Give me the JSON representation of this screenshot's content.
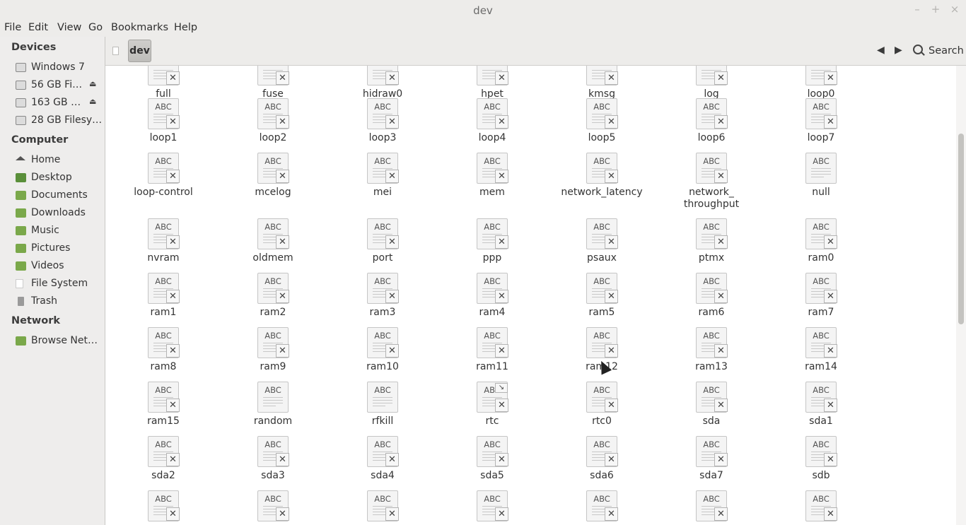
{
  "window": {
    "title": "dev",
    "minimize": "–",
    "maximize": "+",
    "close": "×"
  },
  "menu": [
    "File",
    "Edit",
    "View",
    "Go",
    "Bookmarks",
    "Help"
  ],
  "sidebar": {
    "devices_header": "Devices",
    "devices": [
      {
        "label": "Windows 7",
        "eject": false
      },
      {
        "label": "56 GB Fi…",
        "eject": true
      },
      {
        "label": "163 GB …",
        "eject": true
      },
      {
        "label": "28 GB Filesy…",
        "eject": false
      }
    ],
    "computer_header": "Computer",
    "computer": [
      {
        "label": "Home",
        "icon": "home-icon"
      },
      {
        "label": "Desktop",
        "icon": "desktop-folder-icon"
      },
      {
        "label": "Documents",
        "icon": "documents-folder-icon"
      },
      {
        "label": "Downloads",
        "icon": "downloads-folder-icon"
      },
      {
        "label": "Music",
        "icon": "music-folder-icon"
      },
      {
        "label": "Pictures",
        "icon": "pictures-folder-icon"
      },
      {
        "label": "Videos",
        "icon": "videos-folder-icon"
      },
      {
        "label": "File System",
        "icon": "file-system-icon"
      },
      {
        "label": "Trash",
        "icon": "trash-icon"
      }
    ],
    "network_header": "Network",
    "network": [
      {
        "label": "Browse Net…",
        "icon": "network-icon"
      }
    ],
    "eject_symbol": "⏏"
  },
  "toolbar": {
    "crumb": "dev",
    "back": "◀",
    "forward": "▶",
    "search_label": "Search"
  },
  "files": {
    "icon_text": "ABC",
    "x_symbol": "✕",
    "link_symbol": "↘",
    "rows": [
      [
        "full",
        "fuse",
        "hidraw0",
        "hpet",
        "kmsg",
        "log",
        "loop0"
      ],
      [
        "loop1",
        "loop2",
        "loop3",
        "loop4",
        "loop5",
        "loop6",
        "loop7"
      ],
      [
        "loop-control",
        "mcelog",
        "mei",
        "mem",
        "network_latency",
        "network_\nthroughput",
        "null"
      ],
      [
        "nvram",
        "oldmem",
        "port",
        "ppp",
        "psaux",
        "ptmx",
        "ram0"
      ],
      [
        "ram1",
        "ram2",
        "ram3",
        "ram4",
        "ram5",
        "ram6",
        "ram7"
      ],
      [
        "ram8",
        "ram9",
        "ram10",
        "ram11",
        "ram12",
        "ram13",
        "ram14"
      ],
      [
        "ram15",
        "random",
        "rfkill",
        "rtc",
        "rtc0",
        "sda",
        "sda1"
      ],
      [
        "sda2",
        "sda3",
        "sda4",
        "sda5",
        "sda6",
        "sda7",
        "sdb"
      ],
      [
        "",
        "",
        "",
        "",
        "",
        "",
        ""
      ]
    ],
    "no_x": [
      "null",
      "random",
      "rfkill"
    ],
    "links": [
      "rtc"
    ]
  },
  "colors": {
    "accent": "#a4a3a0",
    "background": "#ffffff",
    "sidebar": "#eeedec"
  }
}
